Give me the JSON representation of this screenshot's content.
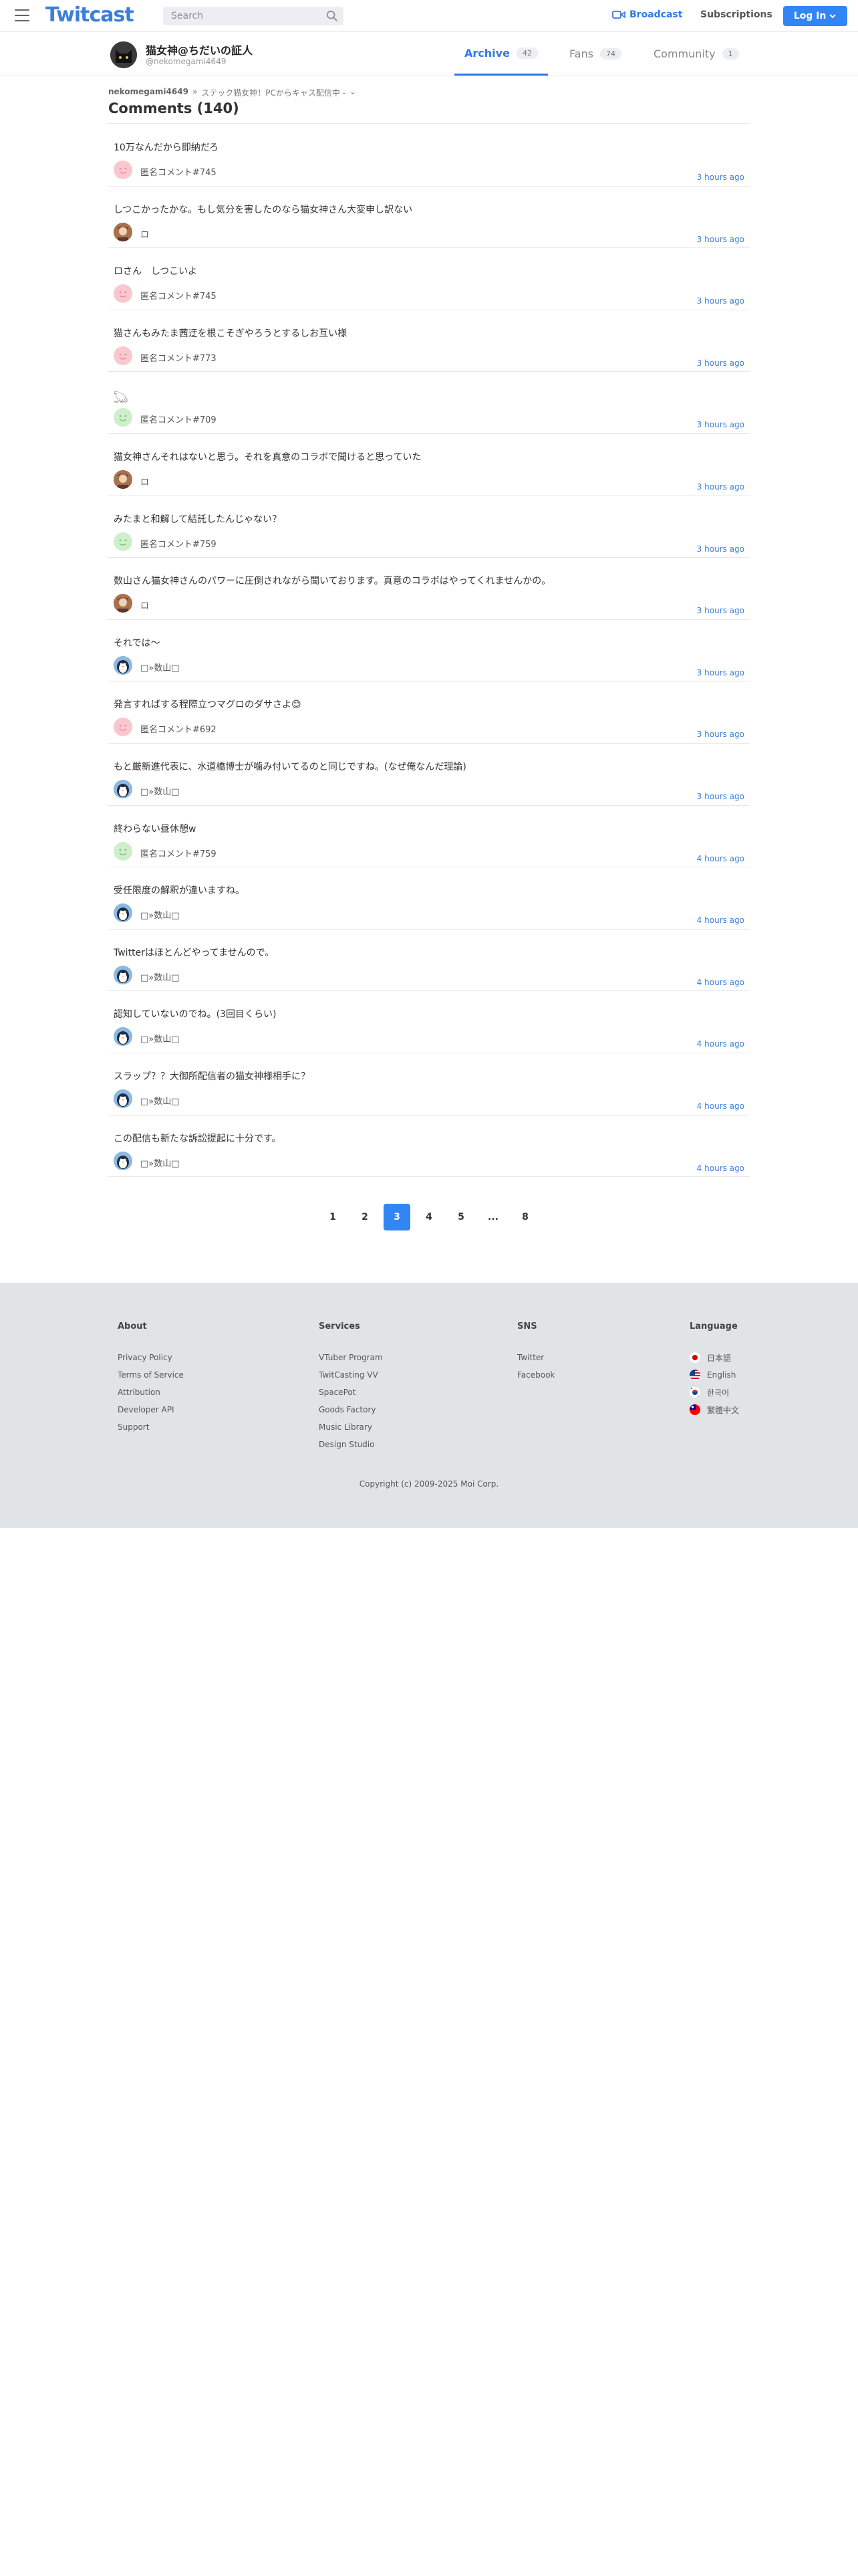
{
  "header": {
    "logo": "Twitcast",
    "search_placeholder": "Search",
    "broadcast_label": "Broadcast",
    "subscriptions_label": "Subscriptions",
    "login_label": "Log In"
  },
  "profile": {
    "name": "猫女神@ちだいの証人",
    "handle": "@nekomegami4649",
    "tabs": [
      {
        "label": "Archive",
        "count": "42"
      },
      {
        "label": "Fans",
        "count": "74"
      },
      {
        "label": "Community",
        "count": "1"
      }
    ]
  },
  "breadcrumb": {
    "user": "nekomegami4649",
    "separator": "»",
    "current": "ステック猫女神！PCからキャス配信中 -",
    "chevron": "⌄"
  },
  "comments_title": "Comments (140)",
  "comments": [
    {
      "text": "10万なんだから即納だろ",
      "name": "匿名コメント#745",
      "time": "3 hours ago",
      "avatar": "pink"
    },
    {
      "text": "しつこかったかな。もし気分を害したのなら猫女神さん大変申し訳ない",
      "name": "ロ",
      "time": "3 hours ago",
      "avatar": "photo"
    },
    {
      "text": "ロさん　しつこいよ",
      "name": "匿名コメント#745",
      "time": "3 hours ago",
      "avatar": "pink"
    },
    {
      "text": "猫さんもみたま茜迂を根こそぎやろうとするしお互い様",
      "name": "匿名コメント#773",
      "time": "3 hours ago",
      "avatar": "pink"
    },
    {
      "text": "𓆏",
      "name": "匿名コメント#709",
      "time": "3 hours ago",
      "avatar": "green"
    },
    {
      "text": "猫女神さんそれはないと思う。それを真意のコラボで聞けると思っていた",
      "name": "ロ",
      "time": "3 hours ago",
      "avatar": "photo"
    },
    {
      "text": "みたまと和解して結託したんじゃない？",
      "name": "匿名コメント#759",
      "time": "3 hours ago",
      "avatar": "green"
    },
    {
      "text": "数山さん猫女神さんのパワーに圧倒されながら聞いております。真意のコラボはやってくれませんかの。",
      "name": "ロ",
      "time": "3 hours ago",
      "avatar": "photo"
    },
    {
      "text": "それでは～",
      "name": "□»数山□",
      "time": "3 hours ago",
      "avatar": "penguin"
    },
    {
      "text": "発言すればする程際立つマグロのダサさよ😊",
      "name": "匿名コメント#692",
      "time": "3 hours ago",
      "avatar": "pink"
    },
    {
      "text": "もと厳新進代表に、水道橋博士が噛み付いてるのと同じですね。(なぜ俺なんだ理論)",
      "name": "□»数山□",
      "time": "3 hours ago",
      "avatar": "penguin"
    },
    {
      "text": "終わらない昼休憩w",
      "name": "匿名コメント#759",
      "time": "4 hours ago",
      "avatar": "green"
    },
    {
      "text": "受任限度の解釈が違いますね。",
      "name": "□»数山□",
      "time": "4 hours ago",
      "avatar": "penguin"
    },
    {
      "text": "Twitterはほとんどやってませんので。",
      "name": "□»数山□",
      "time": "4 hours ago",
      "avatar": "penguin"
    },
    {
      "text": "認知していないのでね。(3回目くらい)",
      "name": "□»数山□",
      "time": "4 hours ago",
      "avatar": "penguin"
    },
    {
      "text": "スラップ？？大御所配信者の猫女神様相手に？",
      "name": "□»数山□",
      "time": "4 hours ago",
      "avatar": "penguin"
    },
    {
      "text": "この配信も新たな訴訟提起に十分です。",
      "name": "□»数山□",
      "time": "4 hours ago",
      "avatar": "penguin"
    }
  ],
  "pagination": {
    "pages": [
      "1",
      "2",
      "3",
      "4",
      "5",
      "...",
      "8"
    ],
    "current": "3"
  },
  "footer": {
    "about": {
      "heading": "About",
      "links": [
        "Privacy Policy",
        "Terms of Service",
        "Attribution",
        "Developer API",
        "Support"
      ]
    },
    "services": {
      "heading": "Services",
      "links": [
        "VTuber Program",
        "TwitCasting VV",
        "SpacePot",
        "Goods Factory",
        "Music Library",
        "Design Studio"
      ]
    },
    "sns": {
      "heading": "SNS",
      "links": [
        "Twitter",
        "Facebook"
      ]
    },
    "language": {
      "heading": "Language",
      "links": [
        "日本語",
        "English",
        "한국어",
        "繁體中文"
      ]
    },
    "copyright": "Copyright (c) 2009-2025 Moi Corp."
  },
  "colors": {
    "brand": "#3b7fd8",
    "button": "#3185f5",
    "footer_bg": "#e1e4e7",
    "avatar_pink": "#f9c8cf",
    "avatar_green": "#cfeecb"
  }
}
